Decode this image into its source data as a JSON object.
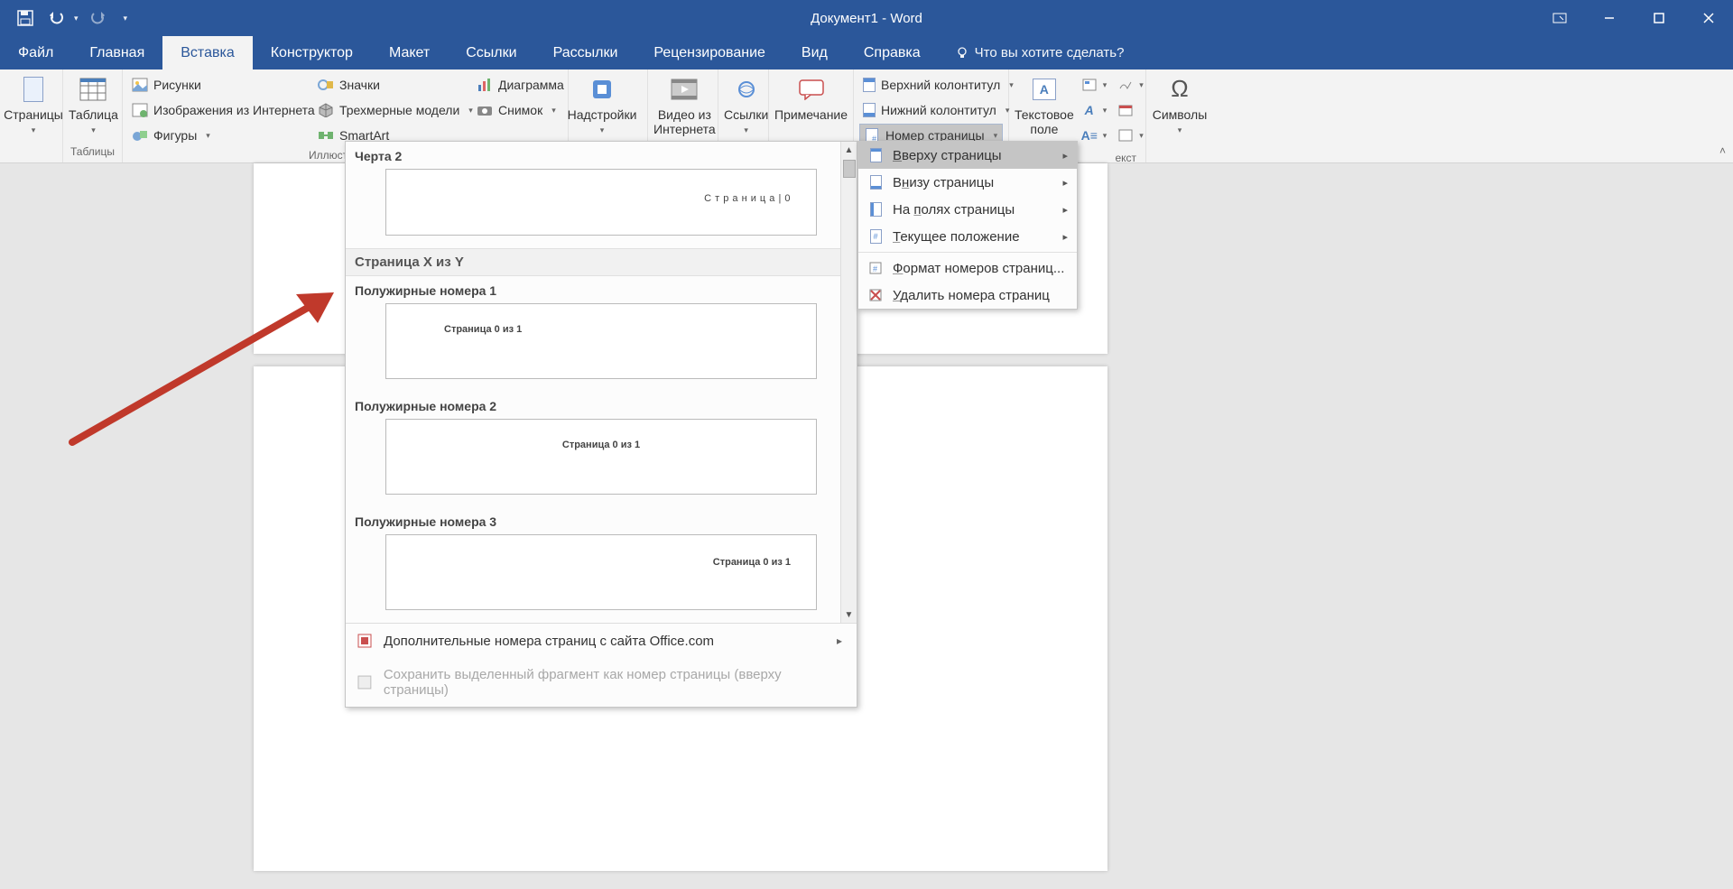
{
  "title": "Документ1  -  Word",
  "tabs": {
    "file": "Файл",
    "home": "Главная",
    "insert": "Вставка",
    "design": "Конструктор",
    "layout": "Макет",
    "references": "Ссылки",
    "mailings": "Рассылки",
    "review": "Рецензирование",
    "view": "Вид",
    "help": "Справка"
  },
  "tell_me": "Что вы хотите сделать?",
  "ribbon": {
    "pages": {
      "label": "Страницы"
    },
    "tables": {
      "label": "Таблицы",
      "button": "Таблица"
    },
    "illustrations": {
      "label": "Иллюстрации",
      "pictures": "Рисунки",
      "online_pictures": "Изображения из Интернета",
      "shapes": "Фигуры",
      "icons": "Значки",
      "models3d": "Трехмерные модели",
      "smartart": "SmartArt",
      "chart": "Диаграмма",
      "screenshot": "Снимок"
    },
    "addins": {
      "label": "Надстройки"
    },
    "media": {
      "label": "Видео из Интернета"
    },
    "links": {
      "label": "Ссылки"
    },
    "comments": {
      "label": "Примечание"
    },
    "header_footer": {
      "header": "Верхний колонтитул",
      "footer": "Нижний колонтитул",
      "page_number": "Номер страницы"
    },
    "text": {
      "textbox": "Текстовое поле",
      "partial": "екст"
    },
    "symbols": {
      "label": "Символы"
    }
  },
  "gallery": {
    "item1_label": "Черта 2",
    "item1_text": "С т р а н и ц а  | 0",
    "section": "Страница X из Y",
    "bold1_label": "Полужирные номера 1",
    "bold1_text": "Страница 0 из 1",
    "bold2_label": "Полужирные номера 2",
    "bold2_text": "Страница 0 из 1",
    "bold3_label": "Полужирные номера 3",
    "bold3_text": "Страница 0 из 1",
    "more": "Дополнительные номера страниц с сайта Office.com",
    "save_sel": "Сохранить выделенный фрагмент как номер страницы (вверху страницы)"
  },
  "pn_menu": {
    "top": "Вверху страницы",
    "bottom": "Внизу страницы",
    "margins": "На полях страницы",
    "current": "Текущее положение",
    "format": "Формат номеров страниц...",
    "remove": "Удалить номера страниц"
  }
}
